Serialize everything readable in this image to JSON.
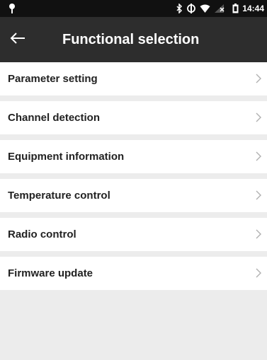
{
  "status_bar": {
    "time": "14:44",
    "icons": [
      "location-pin-icon",
      "bluetooth-icon",
      "sync-icon",
      "wifi-icon",
      "no-signal-icon",
      "battery-icon"
    ]
  },
  "header": {
    "title": "Functional selection",
    "back_icon": "back-arrow-icon"
  },
  "menu": {
    "items": [
      {
        "label": "Parameter setting"
      },
      {
        "label": "Channel detection"
      },
      {
        "label": "Equipment information"
      },
      {
        "label": "Temperature control"
      },
      {
        "label": "Radio control"
      },
      {
        "label": "Firmware update"
      }
    ],
    "chevron_icon": "chevron-right-icon"
  },
  "colors": {
    "status_bar_bg": "#111111",
    "title_bar_bg": "#2d2d2d",
    "page_bg": "#ececec",
    "item_bg": "#ffffff",
    "item_text": "#222222",
    "chevron": "#b0b0b0"
  }
}
